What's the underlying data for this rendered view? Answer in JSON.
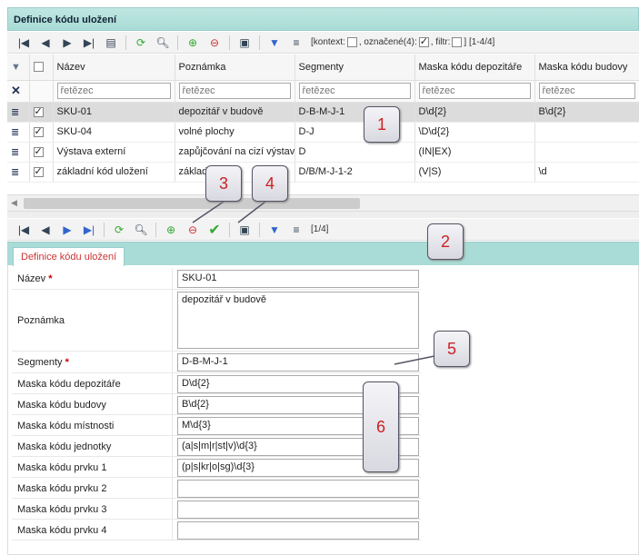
{
  "window": {
    "title": "Definice kódu uložení"
  },
  "toolbar_top": {
    "context_label": "[kontext:",
    "selected_label": ", označené(4):",
    "filter_label": ", filtr:",
    "range_label": "] [1-4/4]"
  },
  "grid": {
    "columns": [
      "Název",
      "Poznámka",
      "Segmenty",
      "Maska kódu depozitáře",
      "Maska kódu budovy"
    ],
    "filter_placeholder": "řetězec",
    "rows": [
      {
        "name": "SKU-01",
        "note": "depozitář v budově",
        "segments": "D-B-M-J-1",
        "depo": "D\\d{2}",
        "building": "B\\d{2}"
      },
      {
        "name": "SKU-04",
        "note": "volné plochy",
        "segments": "D-J",
        "depo": "\\D\\d{2}",
        "building": ""
      },
      {
        "name": "Výstava externí",
        "note": "zapůjčování na cizí výstavy",
        "segments": "D",
        "depo": "(IN|EX)",
        "building": ""
      },
      {
        "name": "základní kód uložení",
        "note": "základní",
        "segments": "D/B/M-J-1-2",
        "depo": "(V|S)",
        "building": "\\d"
      }
    ]
  },
  "toolbar_bottom": {
    "range_label": "[1/4]"
  },
  "form": {
    "tab": "Definice kódu uložení",
    "fields": [
      {
        "label": "Název",
        "value": "SKU-01",
        "required": "*"
      },
      {
        "label": "Poznámka",
        "value": "depozitář v budově"
      },
      {
        "label": "Segmenty",
        "value": "D-B-M-J-1",
        "required": "*"
      },
      {
        "label": "Maska kódu depozitáře",
        "value": "D\\d{2}"
      },
      {
        "label": "Maska kódu budovy",
        "value": "B\\d{2}"
      },
      {
        "label": "Maska kódu místnosti",
        "value": "M\\d{3}"
      },
      {
        "label": "Maska kódu jednotky",
        "value": "(a|s|m|r|st|v)\\d{3}"
      },
      {
        "label": "Maska kódu prvku 1",
        "value": "(p|s|kr|o|sg)\\d{3}"
      },
      {
        "label": "Maska kódu prvku 2",
        "value": ""
      },
      {
        "label": "Maska kódu prvku 3",
        "value": ""
      },
      {
        "label": "Maska kódu prvku 4",
        "value": ""
      }
    ]
  },
  "callouts": [
    "1",
    "2",
    "3",
    "4",
    "5",
    "6"
  ],
  "icons": [
    "first-page-icon",
    "prev-page-icon",
    "next-page-icon",
    "last-page-icon",
    "columns-icon",
    "refresh-icon",
    "search-icon",
    "add-icon",
    "remove-icon",
    "print-icon",
    "filter-icon",
    "filter-clear-icon",
    "confirm-icon",
    "funnel-icon",
    "clear-x-icon",
    "row-menu-icon"
  ],
  "colors": {
    "accent": "#a9dcd6",
    "required": "#cc0000",
    "callout_text": "#cc2222"
  }
}
